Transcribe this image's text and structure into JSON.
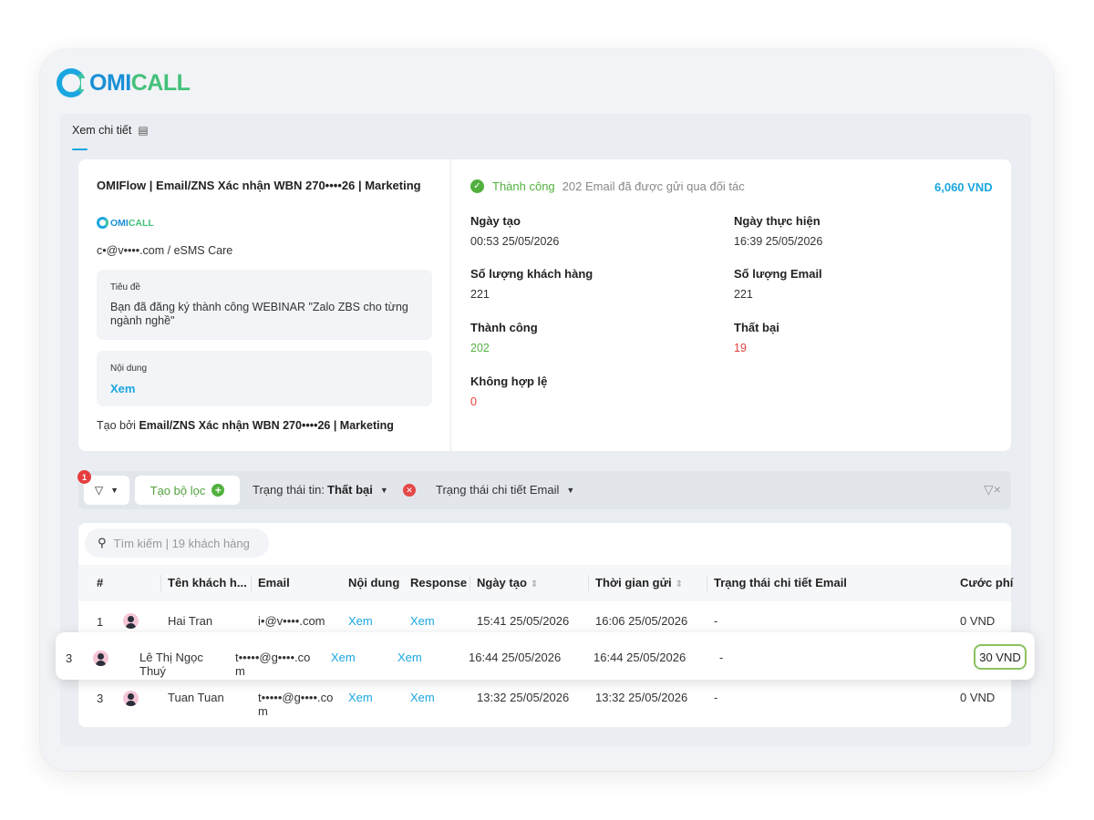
{
  "logo": {
    "part1": "OMI",
    "part2": "CALL"
  },
  "tab": {
    "label": "Xem chi tiết"
  },
  "campaign": {
    "title": "OMIFlow | Email/ZNS Xác nhận WBN 270••••26 | Marketing",
    "mini_logo": {
      "part1": "OMI",
      "part2": "CALL"
    },
    "sender": "c•@v••••.com / eSMS Care",
    "subject_label": "Tiêu đề",
    "subject_text": "Bạn đã đăng ký thành công WEBINAR \"Zalo ZBS cho từng ngành nghề\"",
    "content_label": "Nội dung",
    "content_link": "Xem",
    "created_by_prefix": "Tạo bởi",
    "created_by_name": "Email/ZNS Xác nhận WBN 270••••26 | Marketing"
  },
  "status": {
    "label": "Thành công",
    "description": "202 Email đã được gửi qua đối tác",
    "cost": "6,060 VND",
    "color_success": "#52b13e",
    "color_error": "#e53e3e",
    "color_accent": "#1aa6e0"
  },
  "stats": {
    "created_date_label": "Ngày tạo",
    "created_date": "00:53 25/05/2026",
    "executed_date_label": "Ngày thực hiện",
    "executed_date": "16:39 25/05/2026",
    "customers_label": "Số lượng khách hàng",
    "customers": "221",
    "emails_label": "Số lượng Email",
    "emails": "221",
    "success_label": "Thành công",
    "success": "202",
    "failed_label": "Thất bại",
    "failed": "19",
    "invalid_label": "Không hợp lệ",
    "invalid": "0"
  },
  "filters": {
    "badge_count": "1",
    "create_filter_label": "Tạo bộ lọc",
    "status_filter_label": "Trạng thái tin:",
    "status_filter_value": "Thất bại",
    "detail_filter_label": "Trạng thái chi tiết Email"
  },
  "search": {
    "placeholder": "Tìm kiếm | 19 khách hàng"
  },
  "table": {
    "headers": [
      "#",
      "Tên khách h...",
      "Email",
      "Nội dung",
      "Response",
      "Ngày tạo",
      "Thời gian gửi",
      "Trạng thái chi tiết Email",
      "Cước phí"
    ],
    "rows": [
      {
        "index": "1",
        "name": "Hai Tran",
        "email": "i•@v••••.com",
        "content": "Xem",
        "response": "Xem",
        "created": "15:41 25/05/2026",
        "sent": "16:06 25/05/2026",
        "status": "-",
        "cost": "0 VND"
      },
      {
        "index": "3",
        "name": "Lê Thị Ngọc Thuý",
        "email": "t•••••@g••••.com",
        "content": "Xem",
        "response": "Xem",
        "created": "16:44 25/05/2026",
        "sent": "16:44 25/05/2026",
        "status": "-",
        "cost": "30 VND"
      },
      {
        "index": "3",
        "name": "Tuan Tuan",
        "email": "t•••••@g••••.com",
        "content": "Xem",
        "response": "Xem",
        "created": "13:32 25/05/2026",
        "sent": "13:32 25/05/2026",
        "status": "-",
        "cost": "0 VND"
      }
    ]
  }
}
